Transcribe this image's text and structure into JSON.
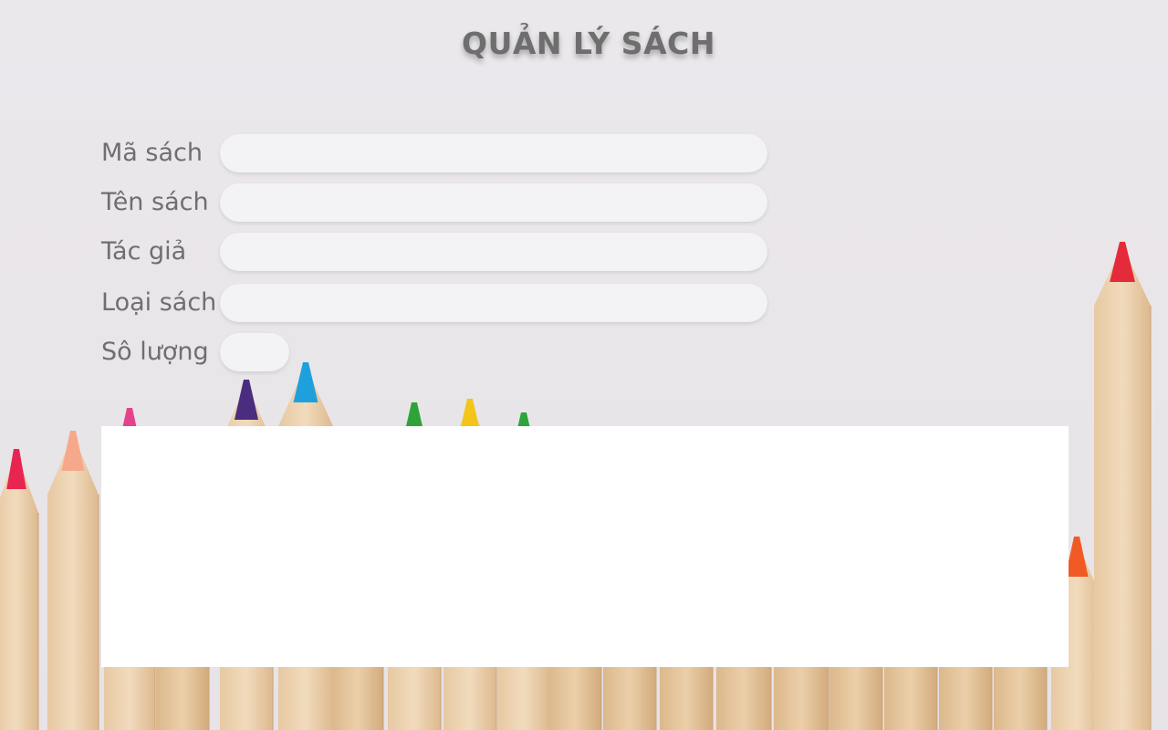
{
  "page": {
    "title": "QUẢN LÝ SÁCH"
  },
  "form": {
    "fields": [
      {
        "label": "Mã sách",
        "value": "",
        "placeholder": ""
      },
      {
        "label": "Tên sách",
        "value": "",
        "placeholder": ""
      },
      {
        "label": "Tác giả",
        "value": "",
        "placeholder": ""
      },
      {
        "label": "Loại sách",
        "value": "",
        "placeholder": ""
      },
      {
        "label": "Sô lượng",
        "value": "",
        "placeholder": ""
      }
    ]
  },
  "background": {
    "description_icon": "colored-pencils-background",
    "pencil_colors": [
      "#e8254f",
      "#f5a98a",
      "#e4438c",
      "#4a2d7e",
      "#1ea0dd",
      "#2fa33a",
      "#f3c51a",
      "#2aa63c",
      "#f05a24",
      "#e52a3b"
    ]
  }
}
